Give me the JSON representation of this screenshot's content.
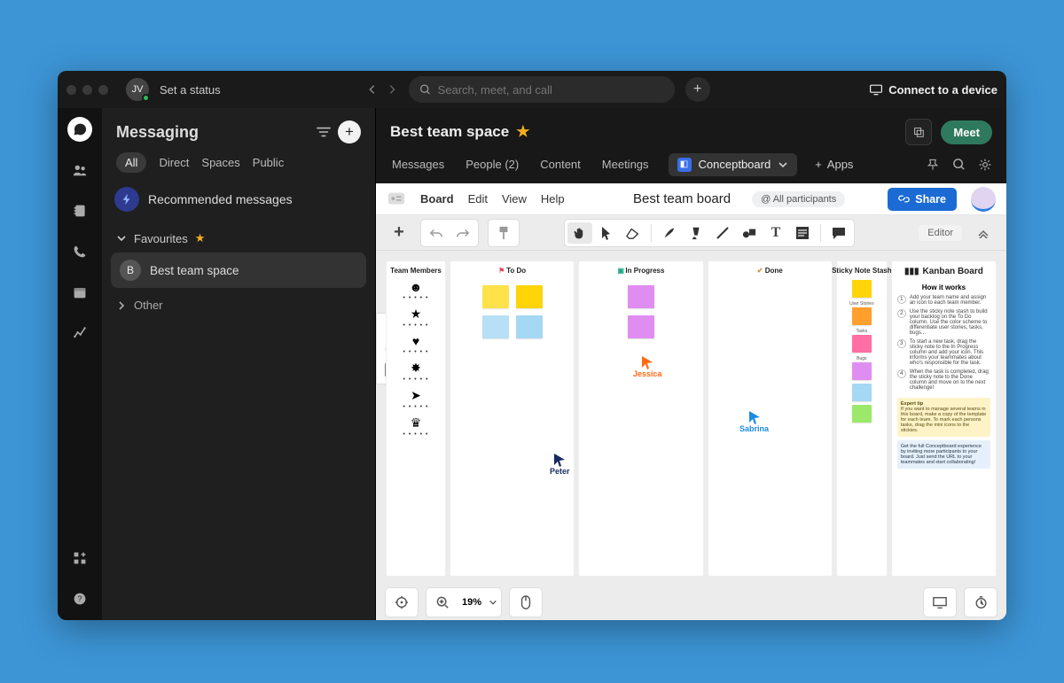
{
  "titlebar": {
    "avatar_initials": "JV",
    "status_prompt": "Set a status",
    "search_placeholder": "Search, meet, and call",
    "connect_label": "Connect to a device"
  },
  "rail": {
    "items": [
      "messaging",
      "contacts",
      "teams",
      "calls",
      "calendar",
      "analytics"
    ],
    "bottom": [
      "apps-grid",
      "help"
    ]
  },
  "sidebar": {
    "title": "Messaging",
    "filters": {
      "all": "All",
      "direct": "Direct",
      "spaces": "Spaces",
      "public": "Public"
    },
    "recommended_label": "Recommended messages",
    "favorites_label": "Favourites",
    "spaces": [
      {
        "badge": "B",
        "name": "Best team space",
        "active": true
      }
    ],
    "other_label": "Other"
  },
  "main": {
    "title": "Best team space",
    "meet_label": "Meet",
    "tabs": {
      "messages": "Messages",
      "people": "People (2)",
      "content": "Content",
      "meetings": "Meetings",
      "app_name": "Conceptboard",
      "add_apps": "Apps"
    }
  },
  "conceptboard": {
    "menu": {
      "board": "Board",
      "edit": "Edit",
      "view": "View",
      "help": "Help"
    },
    "board_name": "Best team board",
    "participants_chip": "@ All participants",
    "share_label": "Share",
    "editor_chip": "Editor",
    "zoom": "19%",
    "columns": {
      "members": "Team Members",
      "todo": "To Do",
      "progress": "In Progress",
      "done": "Done",
      "stash": "Sticky Note Stash",
      "howto_title": "Kanban Board",
      "howto_sub": "How it works"
    },
    "cursors": {
      "jessica": "Jessica",
      "sabrina": "Sabrina",
      "peter": "Peter"
    },
    "howto_steps": [
      "Add your team name and assign an icon to each team member.",
      "Use the sticky note stash to build your backlog on the To Do column. Use the color scheme to differentiate user stories, tasks, bugs...",
      "To start a new task, drag the sticky note to the In Progress column and add your icon. This informs your teammates about who's responsible for the task.",
      "When the task is completed, drag the sticky note to the Done column and move on to the next challenge!"
    ],
    "howto_tip_title": "Expert tip",
    "howto_tip_body": "If you want to manage several teams in this board, make a copy of the template for each team. To mark each persons tasks, drag the mini icons to the stickies.",
    "howto_tip2": "Get the full Conceptboard experience by inviting more participants to your board. Just send the URL to your teammates and start collaborating!",
    "stash_labels": [
      "User Stories",
      "Tasks",
      "Bugs"
    ]
  }
}
